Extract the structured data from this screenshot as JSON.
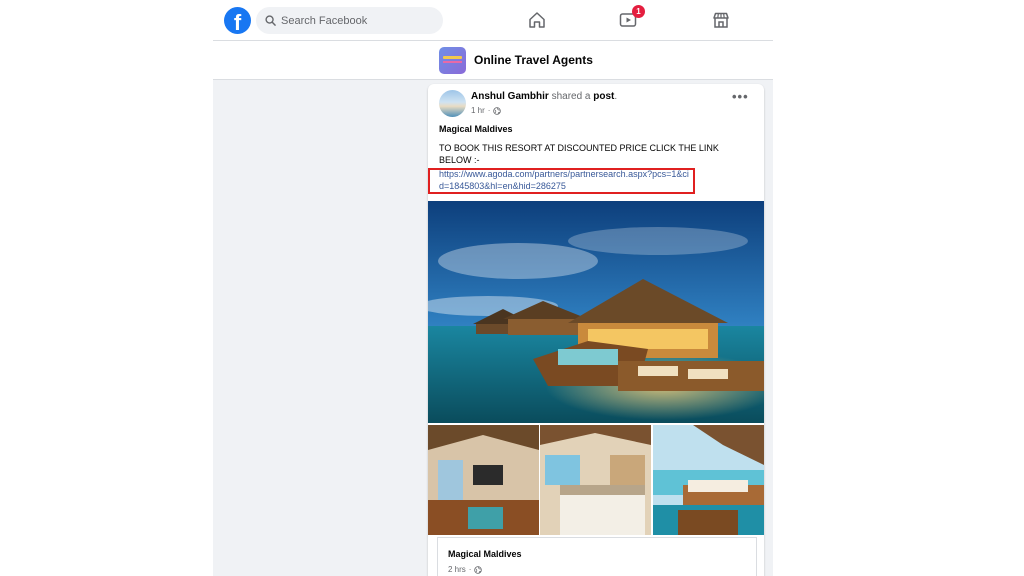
{
  "header": {
    "logo": "f",
    "search": {
      "placeholder": "Search Facebook",
      "value": ""
    },
    "nav": [
      {
        "icon": "home-icon"
      },
      {
        "icon": "watch-icon",
        "badge": "1"
      },
      {
        "icon": "marketplace-icon"
      }
    ]
  },
  "group": {
    "name": "Online Travel Agents"
  },
  "post": {
    "author": "Anshul Gambhir",
    "action": "shared a",
    "object": "post",
    "time": "1 hr",
    "privacy_icon": "globe-icon",
    "title": "Magical Maldives",
    "text": "TO BOOK THIS RESORT AT DISCOUNTED PRICE CLICK THE LINK BELOW :-",
    "link": "https://www.agoda.com/partners/partnersearch.aspx?pcs=1&cid=1845803&hl=en&hid=286275",
    "menu": "•••",
    "shared": {
      "title": "Magical Maldives",
      "time": "2 hrs"
    }
  },
  "colors": {
    "brand": "#1877f2",
    "link": "#385898",
    "highlight": "#e02020",
    "badge": "#e41e3f"
  }
}
